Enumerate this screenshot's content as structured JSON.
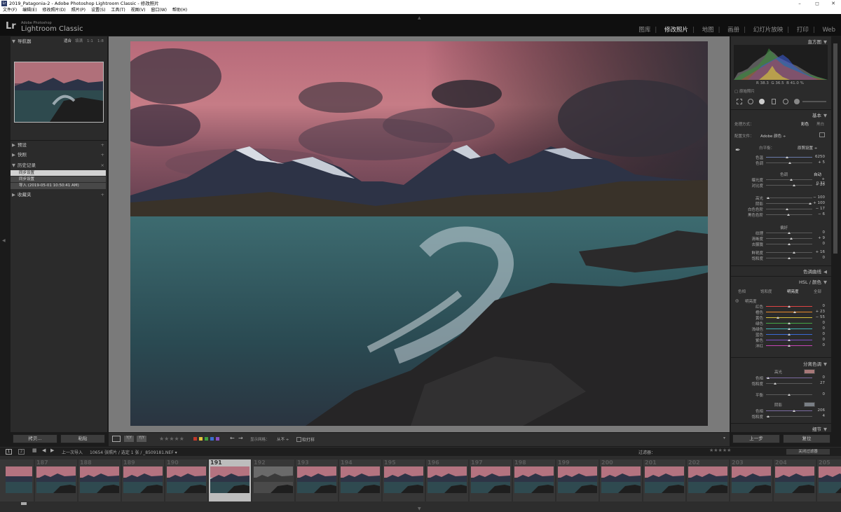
{
  "window": {
    "title": "2019_Patagonia-2 - Adobe Photoshop Lightroom Classic - 修改照片",
    "controls": [
      "–",
      "◻",
      "✕"
    ]
  },
  "menu": [
    "文件(F)",
    "编辑(E)",
    "修改照片(D)",
    "照片(P)",
    "设置(S)",
    "工具(T)",
    "视图(V)",
    "窗口(W)",
    "帮助(H)"
  ],
  "brand": {
    "logo": "Lr",
    "small": "Adobe Photoshop",
    "name": "Lightroom Classic"
  },
  "modules": [
    "图库",
    "修改照片",
    "地图",
    "画册",
    "幻灯片放映",
    "打印",
    "Web"
  ],
  "active_module": "修改照片",
  "left": {
    "navigator": {
      "title": "导航器",
      "fit": "适合",
      "fill": "填满",
      "one": "1:1",
      "ratio": "1:8"
    },
    "presets": "预设",
    "snapshots": "快照",
    "history": {
      "title": "历史记录",
      "close": "×",
      "items": [
        "同步设置",
        "同步设置",
        "导入 (2019-05-01 10:50:41 AM)"
      ]
    },
    "collections": "收藏夹",
    "copy_button": "拷贝...",
    "paste_button": "粘贴"
  },
  "toolbar": {
    "stars": "★★★★★",
    "soft_proof_label": "显示网格：",
    "soft_proof_value": "从不 ÷",
    "softproof": "软打样",
    "swatches": [
      "#c0392b",
      "#e2c33b",
      "#3e9e3e",
      "#3b6fd1",
      "#8a4ec2"
    ]
  },
  "right": {
    "histogram": {
      "title": "直方图",
      "r_label": "R",
      "r_val": "38.3",
      "g_label": "G",
      "g_val": "36.5",
      "b_label": "B",
      "b_val": "41.0",
      "pct": "%",
      "original": "原始照片"
    },
    "basic": {
      "title": "基本",
      "treatment_label": "处理方式：",
      "color": "彩色",
      "bw": "黑白",
      "profile_label": "配置文件：",
      "profile_value": "Adobe 颜色 ÷",
      "wb_label": "白平衡：",
      "wb_value": "原照设置 ÷",
      "tone_title": "色调",
      "auto": "自动",
      "presence_title": "偏好",
      "sliders": [
        {
          "label": "色温",
          "value": "6250"
        },
        {
          "label": "色调",
          "value": "+ 5"
        },
        {
          "label": "曝光度",
          "value": "+ 0.32"
        },
        {
          "label": "对比度",
          "value": "+ 20"
        },
        {
          "label": "高光",
          "value": "− 100"
        },
        {
          "label": "阴影",
          "value": "+ 100"
        },
        {
          "label": "白色色阶",
          "value": "− 17"
        },
        {
          "label": "黑色色阶",
          "value": "− 6"
        },
        {
          "label": "纹理",
          "value": "0"
        },
        {
          "label": "清晰度",
          "value": "+ 9"
        },
        {
          "label": "去朦胧",
          "value": "0"
        },
        {
          "label": "鲜艳度",
          "value": "+ 16"
        },
        {
          "label": "饱和度",
          "value": "0"
        }
      ]
    },
    "tone_curve": "色调曲线",
    "hsl": {
      "title": "HSL / 颜色",
      "tabs": [
        "色相",
        "饱和度",
        "明亮度",
        "全部"
      ],
      "active_tab": "明亮度",
      "section": "明亮度",
      "sliders": [
        {
          "label": "红色",
          "value": "0",
          "color": "#d44"
        },
        {
          "label": "橙色",
          "value": "+ 23",
          "color": "#e88a2c"
        },
        {
          "label": "黄色",
          "value": "− 55",
          "color": "#d6c23a"
        },
        {
          "label": "绿色",
          "value": "0",
          "color": "#45a845"
        },
        {
          "label": "浅绿色",
          "value": "0",
          "color": "#3fb3b3"
        },
        {
          "label": "蓝色",
          "value": "0",
          "color": "#3a6ad6"
        },
        {
          "label": "紫色",
          "value": "0",
          "color": "#7c4ec8"
        },
        {
          "label": "洋红",
          "value": "0",
          "color": "#c646b5"
        }
      ]
    },
    "split": {
      "title": "分离色调",
      "highlights": "高光",
      "shadows": "阴影",
      "balance": "平衡",
      "sliders": [
        {
          "label": "色相",
          "value": "0"
        },
        {
          "label": "饱和度",
          "value": "27"
        },
        {
          "label": "平衡",
          "value": "0"
        },
        {
          "label": "色相",
          "value": "206"
        },
        {
          "label": "饱和度",
          "value": "4"
        }
      ]
    },
    "detail": "细节",
    "prev_button": "上一步",
    "reset_button": "复位"
  },
  "filmstrip": {
    "nav_text": "上一次导入",
    "count_text": "10654 张照片 / 选定 1 张 / _8509181.NEF ▾",
    "filter_label": "过滤器：",
    "filter_value": "关闭过滤器",
    "page1": "1",
    "page2": "2",
    "numbers": [
      "187",
      "188",
      "189",
      "190",
      "191",
      "192",
      "193",
      "194",
      "195",
      "196",
      "197",
      "198",
      "199",
      "200",
      "201",
      "202",
      "203",
      "204",
      "205"
    ],
    "selected": "191"
  }
}
